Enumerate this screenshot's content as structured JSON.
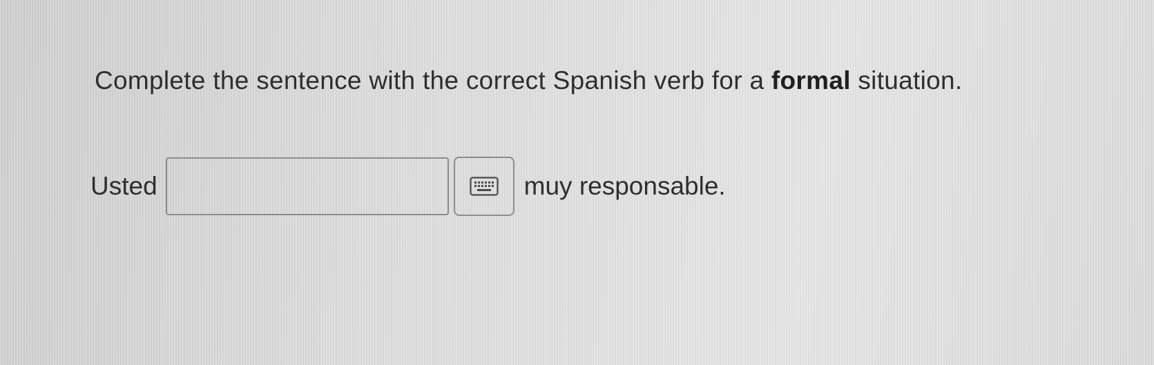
{
  "question": {
    "text_before": "Complete the sentence with the correct Spanish verb for a ",
    "bold_word": "formal",
    "text_after": " situation."
  },
  "answer_row": {
    "prefix": "Usted",
    "input_value": "",
    "input_placeholder": "",
    "keyboard_icon": "keyboard-icon",
    "suffix": "muy responsable."
  },
  "colors": {
    "text": "#2e2e2e",
    "border": "#8d8d8d",
    "background": "#dcdcdc"
  }
}
